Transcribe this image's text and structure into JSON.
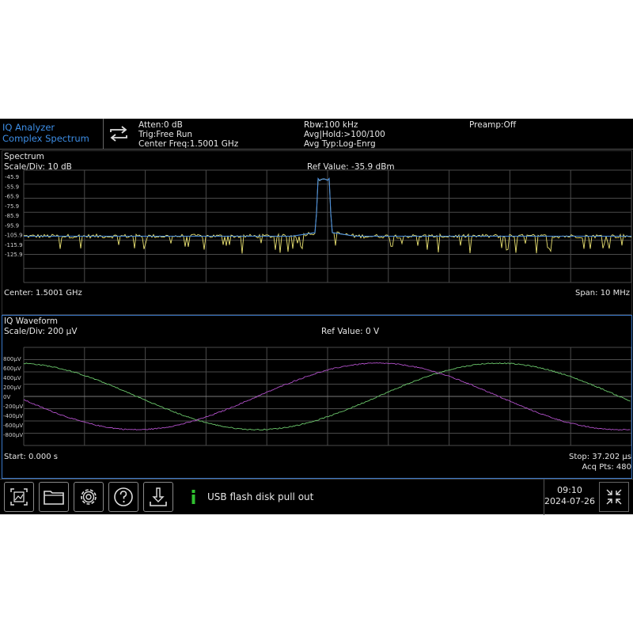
{
  "header": {
    "mode_line1": "IQ Analyzer",
    "mode_line2": "Complex Spectrum",
    "atten": "Atten:0 dB",
    "trig": "Trig:Free Run",
    "center_freq": "Center Freq:1.5001 GHz",
    "rbw": "Rbw:100 kHz",
    "avg_hold": "Avg|Hold:>100/100",
    "avg_type": "Avg Typ:Log-Enrg",
    "preamp": "Preamp:Off"
  },
  "spectrum": {
    "title": "Spectrum",
    "scale": "Scale/Div: 10 dB",
    "ref_value": "Ref Value: -35.9 dBm",
    "center": "Center: 1.5001 GHz",
    "span": "Span: 10 MHz",
    "y_ticks": [
      "-45.9",
      "-55.9",
      "-65.9",
      "-75.9",
      "-85.9",
      "-95.9",
      "-105.9",
      "-115.9",
      "-125.9"
    ],
    "trace_colors": {
      "live": "#e8e070",
      "average": "#4a8fe0"
    }
  },
  "iq_waveform": {
    "title": "IQ Waveform",
    "scale": "Scale/Div: 200 µV",
    "ref_value": "Ref Value: 0 V",
    "start": "Start: 0.000 s",
    "stop": "Stop: 37.202 µs",
    "acq_pts": "Acq Pts: 480",
    "y_ticks": [
      "800µV",
      "600µV",
      "400µV",
      "200µV",
      "0V",
      "-200µV",
      "-400µV",
      "-600µV",
      "-800µV"
    ],
    "trace_colors": {
      "i": "#6cc86c",
      "q": "#b050c8"
    }
  },
  "toolbar": {
    "buttons": [
      "screenshot-icon",
      "folder-icon",
      "gear-icon",
      "help-icon",
      "download-icon"
    ],
    "message": "USB flash disk pull out",
    "message_color": "#30c030"
  },
  "clock": {
    "time": "09:10",
    "date": "2024-07-26"
  }
}
